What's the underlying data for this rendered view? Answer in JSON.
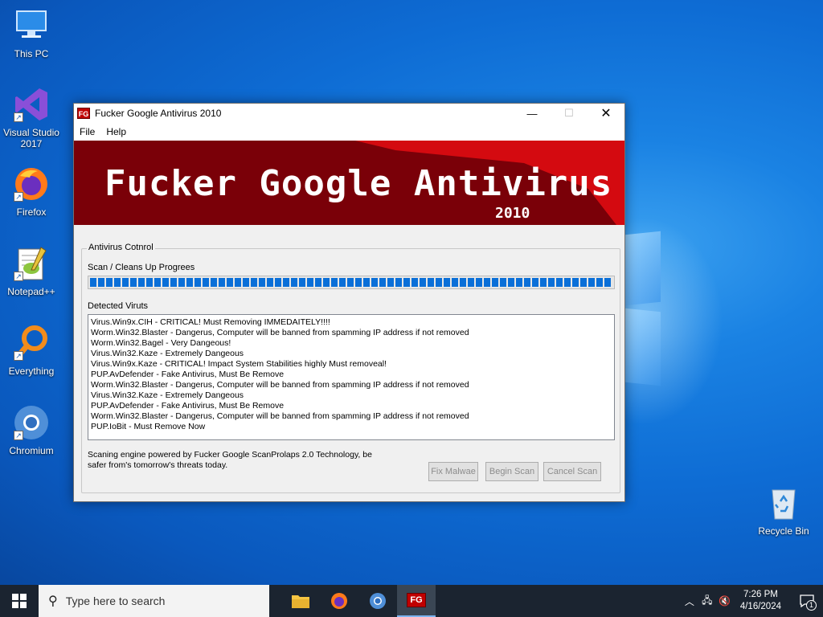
{
  "desktop": {
    "icons": [
      {
        "label": "This PC"
      },
      {
        "label": "Visual Studio 2017"
      },
      {
        "label": "Firefox"
      },
      {
        "label": "Notepad++"
      },
      {
        "label": "Everything"
      },
      {
        "label": "Chromium"
      },
      {
        "label": "Recycle Bin"
      }
    ]
  },
  "window": {
    "title": "Fucker Google Antivirus 2010",
    "icon_text": "FG",
    "minimize_glyph": "—",
    "maximize_glyph": "☐",
    "close_glyph": "✕",
    "menu": [
      "File",
      "Help"
    ],
    "banner_title": "Fucker Google Antivirus",
    "banner_year": "2010",
    "group_label": "Antivirus Cotnrol",
    "progress_label": "Scan / Cleans Up Progrees",
    "progress_percent": 100,
    "log_label": "Detected Viruts",
    "log_lines": [
      "Virus.Win9x.CIH - CRITICAL! Must Removing IMMEDAITELY!!!!",
      "Worm.Win32.Blaster - Dangerus, Computer will be banned from spamming IP address if not removed",
      "Worm.Win32.Bagel - Very Dangeous!",
      "Virus.Win32.Kaze  - Extremely Dangeous",
      "Virus.Win9x.Kaze - CRITICAL! Impact System Stabilities highly Must removeal!",
      "PUP.AvDefender - Fake Antivirus, Must Be Remove",
      "Worm.Win32.Blaster - Dangerus, Computer will be banned from spamming IP address if not removed",
      "Virus.Win32.Kaze  - Extremely Dangeous",
      "PUP.AvDefender - Fake Antivirus, Must Be Remove",
      "Worm.Win32.Blaster - Dangerus, Computer will be banned from spamming IP address if not removed",
      "PUP.IoBit - Must Remove Now"
    ],
    "footer_text": "Scaning engine powered by Fucker Google ScanProlaps 2.0 Technology, be safer from's tomorrow's threats today.",
    "buttons": {
      "fix": "Fix Malwae",
      "begin": "Begin Scan",
      "cancel": "Cancel Scan"
    }
  },
  "taskbar": {
    "search_placeholder": "Type here to search",
    "time": "7:26 PM",
    "date": "4/16/2024",
    "notification_count": "1",
    "active_app_text": "FG"
  },
  "colors": {
    "accent": "#0a6fd8",
    "banner_red": "#d40a10",
    "banner_dark": "#7a0008"
  }
}
